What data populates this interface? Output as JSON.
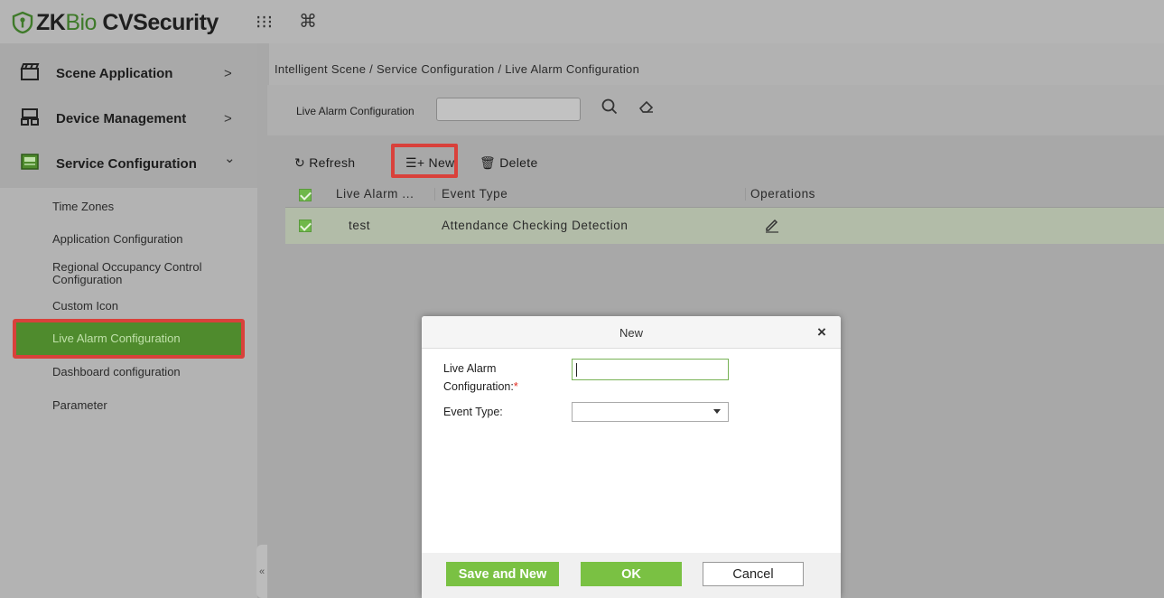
{
  "app": {
    "logo_prefix": "ZK",
    "logo_bio": "Bio",
    "logo_suffix": " CVSecurity"
  },
  "topbar": {
    "grid_icon": "⁝⁝⁝",
    "cmd_icon": "⌘"
  },
  "sidebar": {
    "groups": [
      {
        "label": "Scene Application",
        "chevron": ">"
      },
      {
        "label": "Device Management",
        "chevron": ">"
      },
      {
        "label": "Service Configuration",
        "chevron": "⌄"
      }
    ],
    "items": [
      {
        "label": "Time Zones"
      },
      {
        "label": "Application Configuration"
      },
      {
        "label": "Regional Occupancy Control Configuration"
      },
      {
        "label": "Custom Icon"
      },
      {
        "label": "Live Alarm Configuration"
      },
      {
        "label": "Dashboard configuration"
      },
      {
        "label": "Parameter"
      }
    ],
    "collapse": "«"
  },
  "breadcrumb": "Intelligent Scene / Service Configuration / Live Alarm Configuration",
  "search": {
    "label": "Live Alarm Configuration",
    "value": ""
  },
  "toolbar": {
    "refresh": "Refresh",
    "new": "New",
    "delete": "Delete"
  },
  "table": {
    "columns": [
      "Live Alarm ...",
      "Event Type",
      "Operations"
    ],
    "rows": [
      {
        "name": "test",
        "event_type": "Attendance Checking Detection"
      }
    ]
  },
  "dialog": {
    "title": "New",
    "close": "×",
    "name_label_1": "Live Alarm",
    "name_label_2": "Configuration:",
    "required_mark": "*",
    "event_type_label": "Event Type:",
    "name_value": "",
    "event_type_value": "",
    "save_and_new": "Save and New",
    "ok": "OK",
    "cancel": "Cancel"
  },
  "colors": {
    "accent": "#7ac143",
    "highlight": "#d9413b",
    "active_menu": "#4f8b2d"
  }
}
